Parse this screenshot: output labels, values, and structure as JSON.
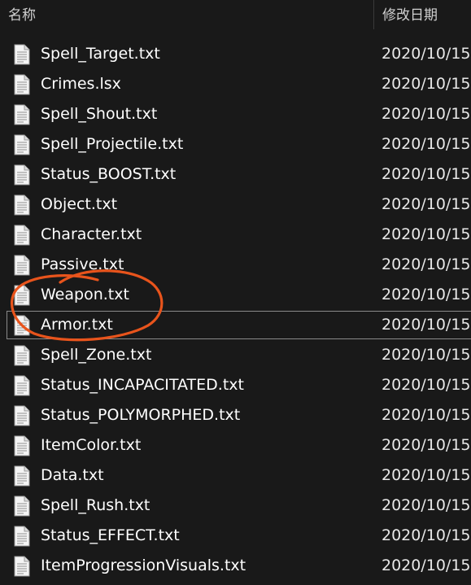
{
  "header": {
    "name_label": "名称",
    "date_label": "修改日期"
  },
  "files": [
    {
      "name": "Spell_Target.txt",
      "date": "2020/10/15"
    },
    {
      "name": "Crimes.lsx",
      "date": "2020/10/15"
    },
    {
      "name": "Spell_Shout.txt",
      "date": "2020/10/15"
    },
    {
      "name": "Spell_Projectile.txt",
      "date": "2020/10/15"
    },
    {
      "name": "Status_BOOST.txt",
      "date": "2020/10/15"
    },
    {
      "name": "Object.txt",
      "date": "2020/10/15"
    },
    {
      "name": "Character.txt",
      "date": "2020/10/15"
    },
    {
      "name": "Passive.txt",
      "date": "2020/10/15"
    },
    {
      "name": "Weapon.txt",
      "date": "2020/10/15"
    },
    {
      "name": "Armor.txt",
      "date": "2020/10/15"
    },
    {
      "name": "Spell_Zone.txt",
      "date": "2020/10/15"
    },
    {
      "name": "Status_INCAPACITATED.txt",
      "date": "2020/10/15"
    },
    {
      "name": "Status_POLYMORPHED.txt",
      "date": "2020/10/15"
    },
    {
      "name": "ItemColor.txt",
      "date": "2020/10/15"
    },
    {
      "name": "Data.txt",
      "date": "2020/10/15"
    },
    {
      "name": "Spell_Rush.txt",
      "date": "2020/10/15"
    },
    {
      "name": "Status_EFFECT.txt",
      "date": "2020/10/15"
    },
    {
      "name": "ItemProgressionVisuals.txt",
      "date": "2020/10/15"
    }
  ],
  "selected_file": "Armor.txt",
  "annotation": {
    "shape": "hand-drawn-circle",
    "color": "#e8541c",
    "encircled_files": [
      "Weapon.txt",
      "Armor.txt"
    ]
  },
  "colors": {
    "background": "#191919",
    "text": "#ffffff",
    "selection_border": "#8a8a8a"
  }
}
